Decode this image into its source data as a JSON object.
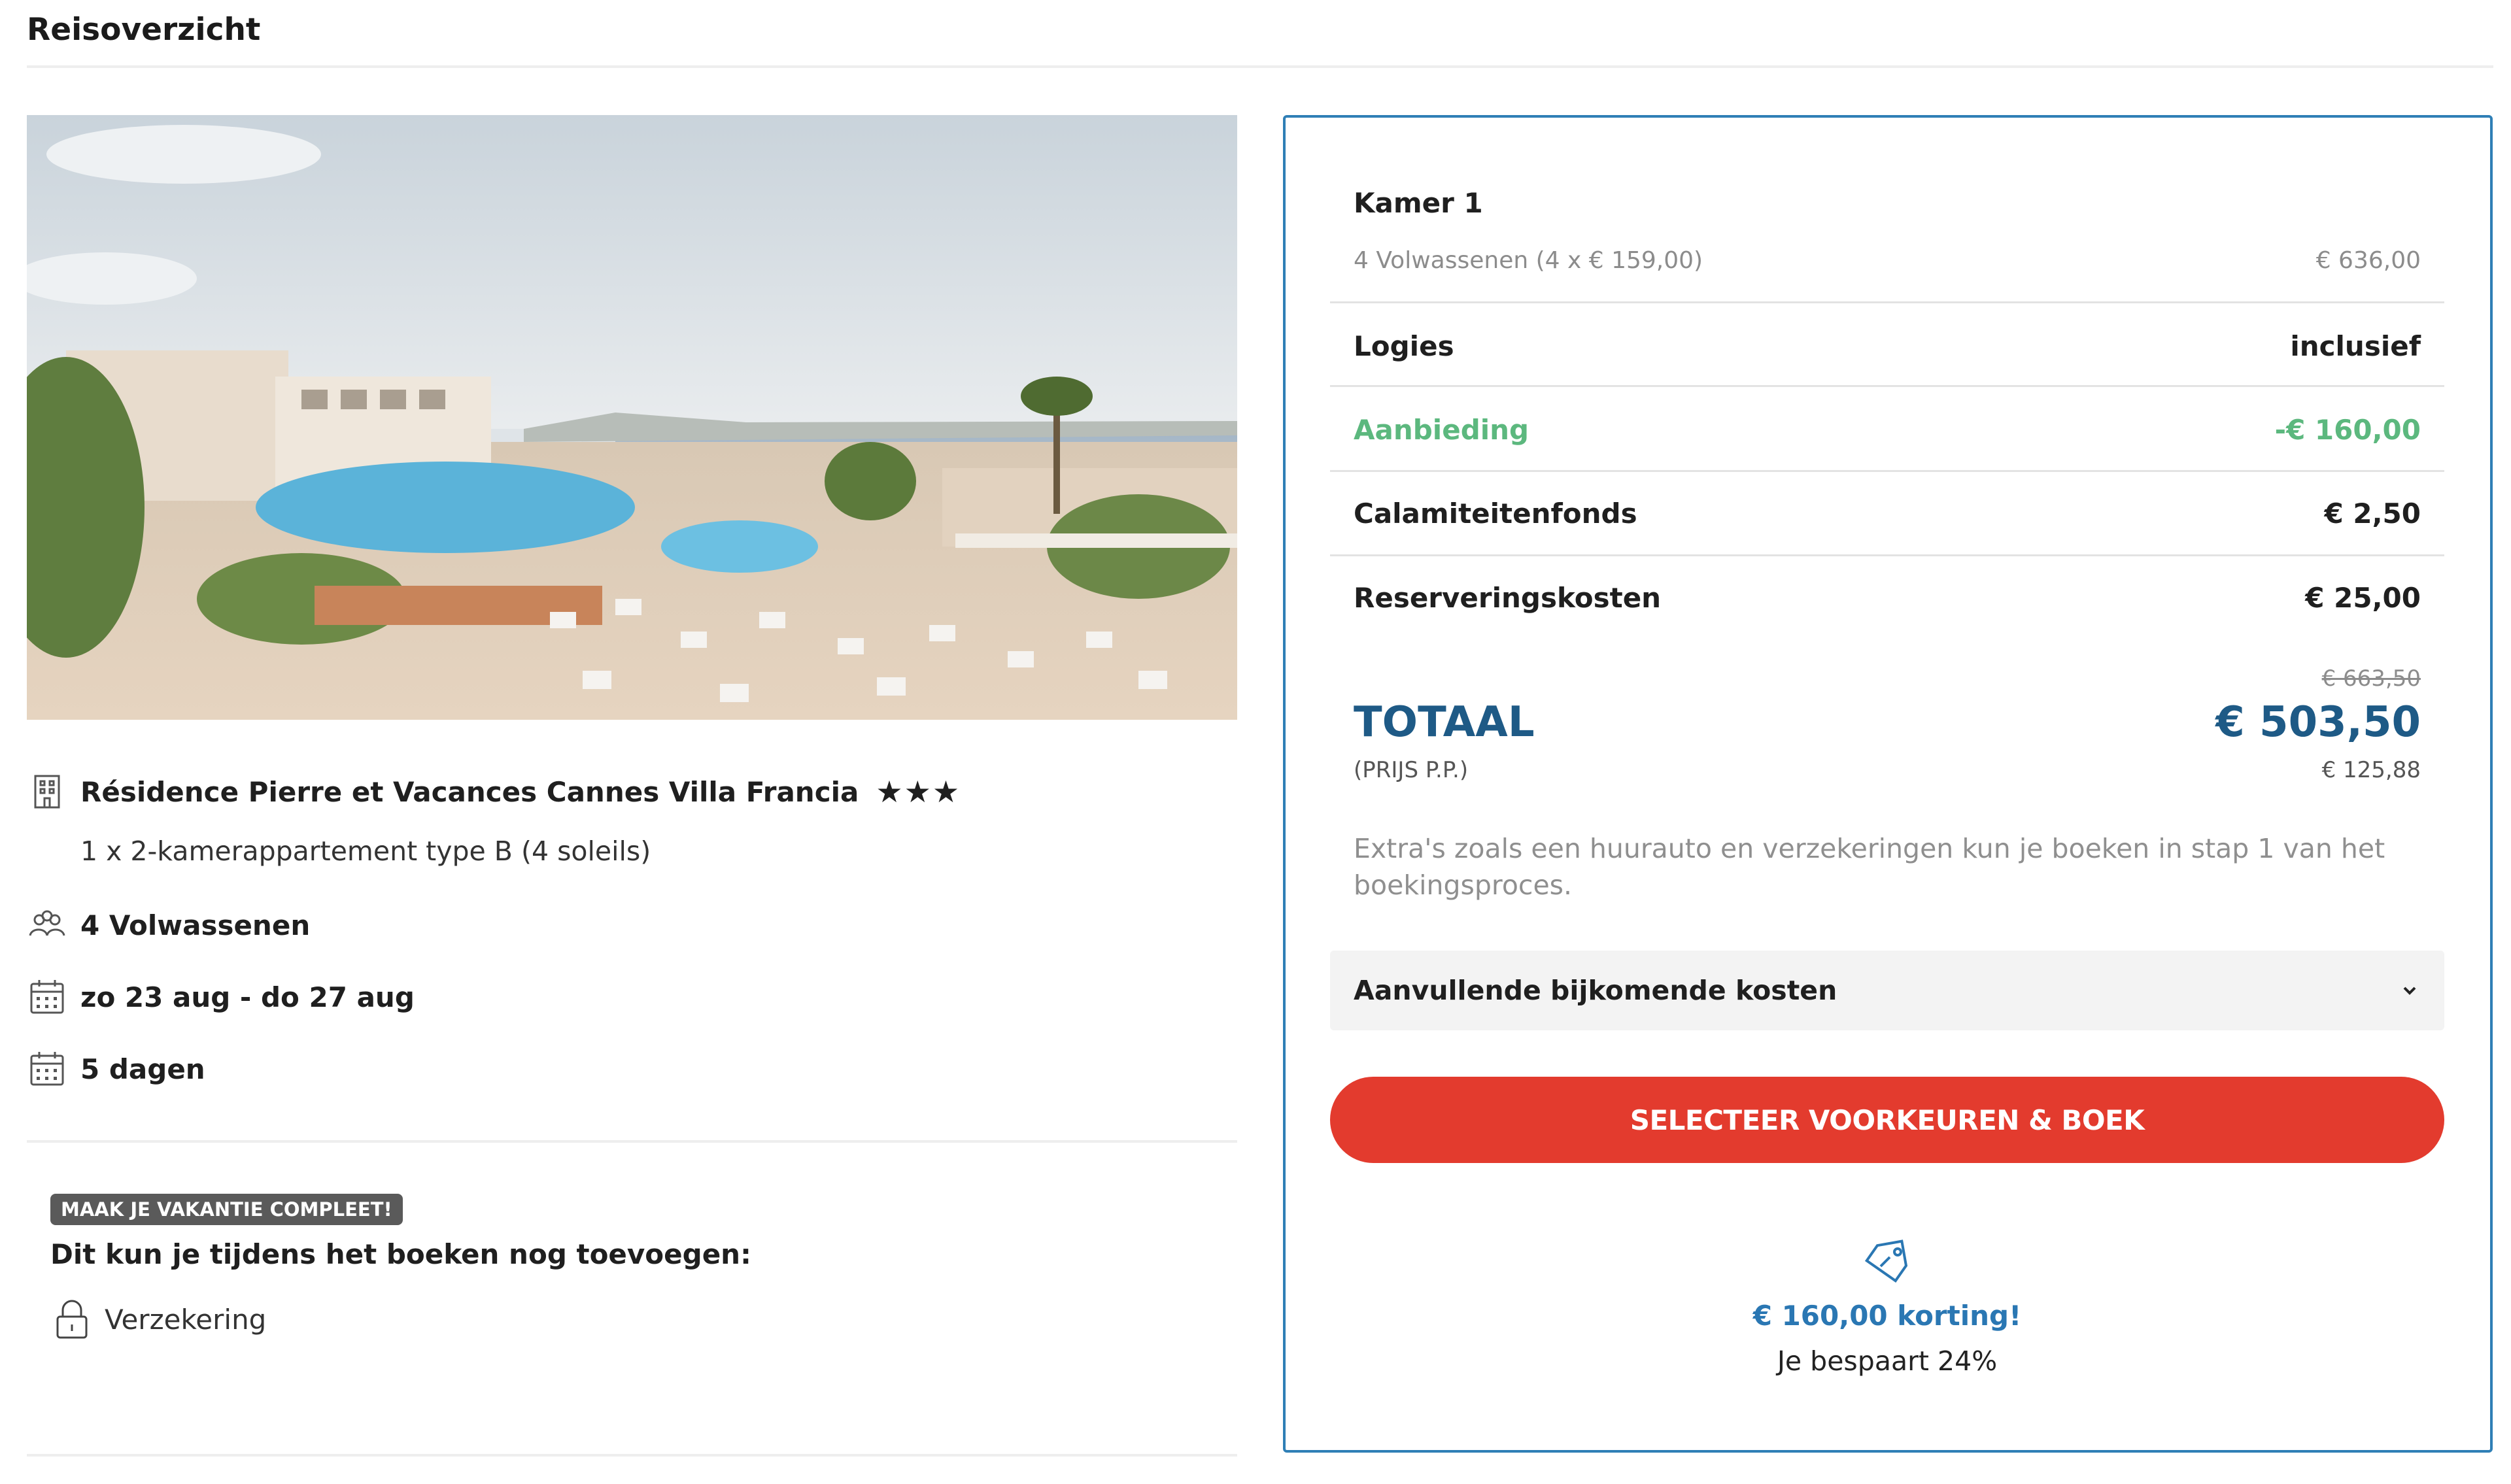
{
  "page": {
    "title": "Reisoverzicht"
  },
  "accommodation": {
    "name": "Résidence Pierre et Vacances Cannes Villa Francia",
    "stars": 3,
    "room_description": "1 x 2-kamerappartement type B (4 soleils)",
    "travellers": "4 Volwassenen",
    "dates": "zo 23 aug - do 27 aug",
    "duration": "5 dagen",
    "icons": {
      "building": "building-icon",
      "travellers": "people-icon",
      "dates": "calendar-icon",
      "duration": "calendar-icon"
    }
  },
  "promo": {
    "badge": "MAAK JE VAKANTIE COMPLEET!",
    "heading": "Dit kun je tijdens het boeken nog toevoegen:",
    "items": [
      {
        "label": "Verzekering",
        "icon": "lock-icon"
      }
    ]
  },
  "price_panel": {
    "room": {
      "title": "Kamer 1",
      "detail_label": "4 Volwassenen (4 x € 159,00)",
      "detail_value": "€ 636,00"
    },
    "lines": [
      {
        "label": "Logies",
        "value": "inclusief"
      },
      {
        "label": "Aanbieding",
        "value": "-€ 160,00"
      },
      {
        "label": "Calamiteitenfonds",
        "value": "€ 2,50"
      },
      {
        "label": "Reserveringskosten",
        "value": "€ 25,00"
      }
    ],
    "total": {
      "old_value": "€ 663,50",
      "label": "TOTAAL",
      "value": "€ 503,50",
      "pp_label": "(PRIJS P.P.)",
      "pp_value": "€ 125,88"
    },
    "extras_note": "Extra's zoals een huurauto en verzekeringen kun je boeken in stap 1 van het boekingsproces.",
    "accordion_label": "Aanvullende bijkomende kosten",
    "cta_label": "SELECTEER VOORKEUREN & BOEK",
    "discount": "€ 160,00 korting!",
    "saving": "Je bespaart 24%"
  },
  "colors": {
    "accent_blue": "#1e5a86",
    "panel_border": "#2f7fb6",
    "discount_blue": "#2a77b3",
    "offer_green": "#5cb87e",
    "cta_red": "#e33b2e",
    "badge_grey": "#5a5a5a"
  }
}
